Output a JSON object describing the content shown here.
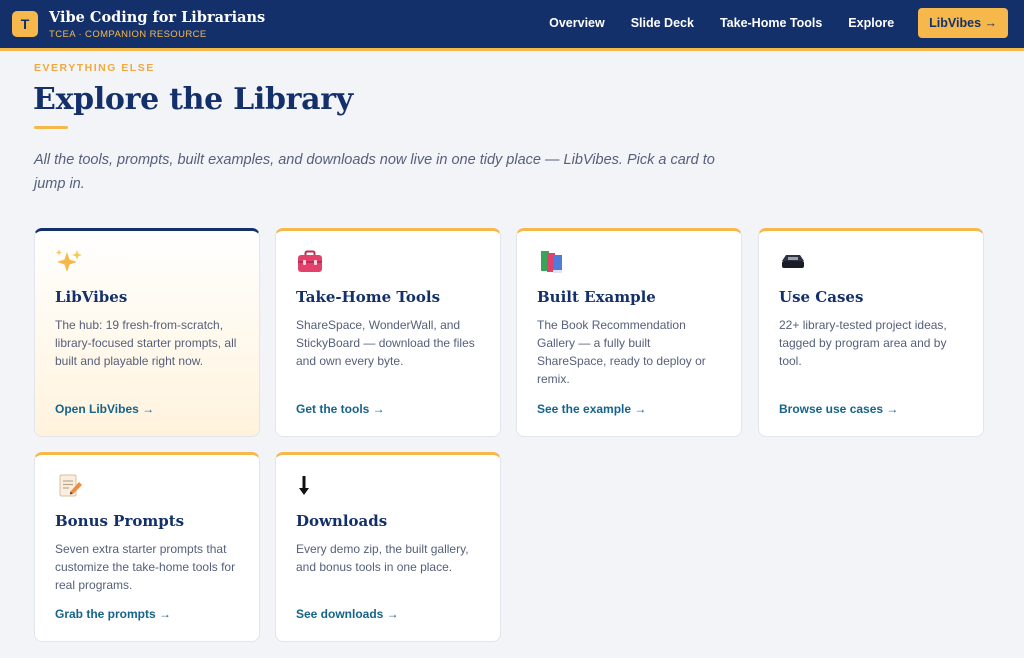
{
  "header": {
    "badge": "T",
    "title": "Vibe Coding for Librarians",
    "subtitle": "TCEA · COMPANION RESOURCE",
    "nav": [
      "Overview",
      "Slide Deck",
      "Take-Home Tools",
      "Explore"
    ],
    "cta": "LibVibes →"
  },
  "hero": {
    "eyebrow": "EVERYTHING ELSE",
    "title": "Explore the Library",
    "intro": "All the tools, prompts, built examples, and downloads now live in one tidy place — LibVibes. Pick a card to jump in."
  },
  "cards": [
    {
      "icon": "sparkles-icon",
      "title": "LibVibes",
      "desc": "The hub: 19 fresh-from-scratch, library-focused starter prompts, all built and playable right now.",
      "link": "Open LibVibes →"
    },
    {
      "icon": "toolbox-icon",
      "title": "Take-Home Tools",
      "desc": "ShareSpace, WonderWall, and StickyBoard — download the files and own every byte.",
      "link": "Get the tools →"
    },
    {
      "icon": "books-icon",
      "title": "Built Example",
      "desc": "The Book Recommendation Gallery — a fully built ShareSpace, ready to deploy or remix.",
      "link": "See the example →"
    },
    {
      "icon": "inbox-tray-icon",
      "title": "Use Cases",
      "desc": "22+ library-tested project ideas, tagged by program area and by tool.",
      "link": "Browse use cases →"
    },
    {
      "icon": "memo-icon",
      "title": "Bonus Prompts",
      "desc": "Seven extra starter prompts that customize the take-home tools for real programs.",
      "link": "Grab the prompts →"
    },
    {
      "icon": "down-arrow-icon",
      "title": "Downloads",
      "desc": "Every demo zip, the built gallery, and bonus tools in one place.",
      "link": "See downloads →"
    }
  ],
  "colors": {
    "navy": "#14306b",
    "gold": "#f7b84b",
    "link": "#16648a",
    "background": "#f3f4f8"
  }
}
